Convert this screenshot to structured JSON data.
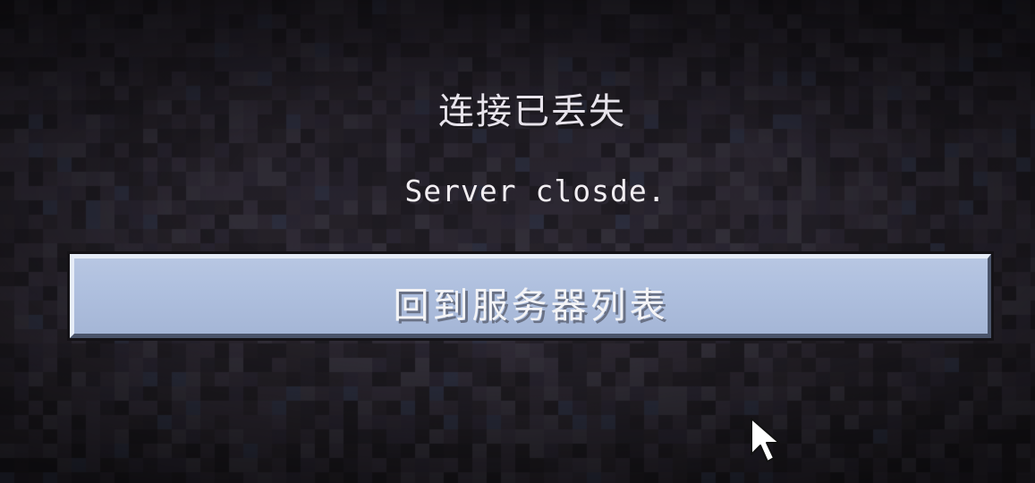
{
  "screen": {
    "title": "连接已丢失",
    "message": "Server closde."
  },
  "actions": {
    "back_to_server_list": "回到服务器列表"
  },
  "colors": {
    "background_dark": "#232026",
    "button_face": "#aebfde",
    "button_highlight": "#e6ecf7",
    "button_shadow": "#4a546a",
    "text": "#f2eef2"
  },
  "icons": {
    "cursor": "arrow-cursor-icon"
  }
}
